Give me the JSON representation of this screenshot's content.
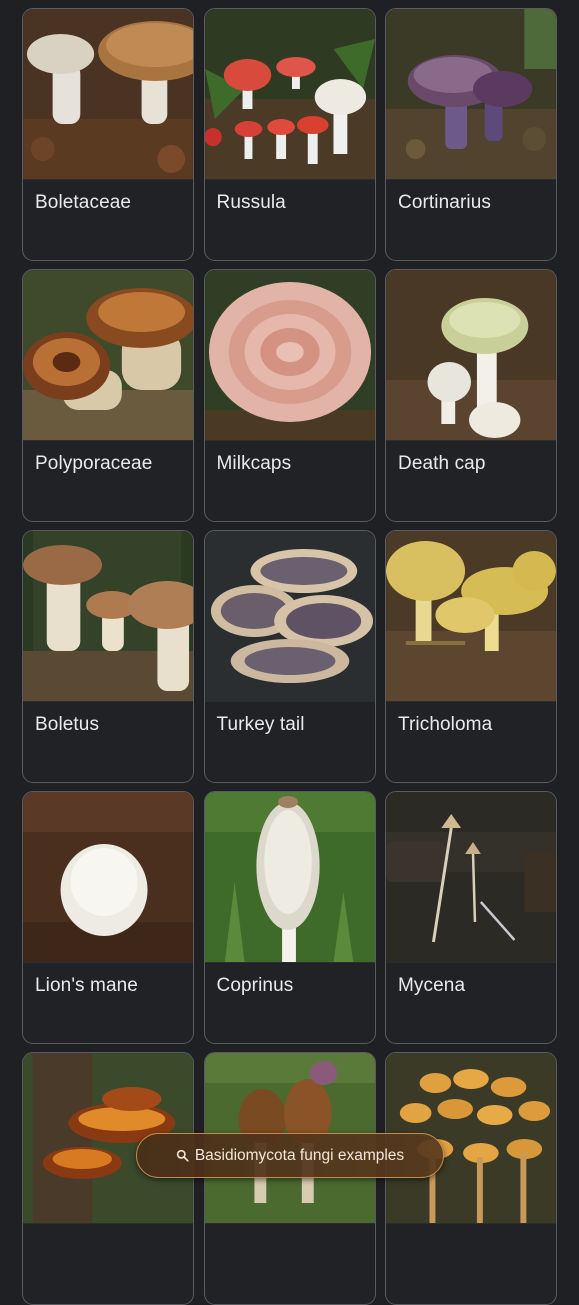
{
  "cards": [
    {
      "label": "Boletaceae"
    },
    {
      "label": "Russula"
    },
    {
      "label": "Cortinarius"
    },
    {
      "label": "Polyporaceae"
    },
    {
      "label": "Milkcaps"
    },
    {
      "label": "Death cap"
    },
    {
      "label": "Boletus"
    },
    {
      "label": "Turkey tail"
    },
    {
      "label": "Tricholoma"
    },
    {
      "label": "Lion's mane"
    },
    {
      "label": "Coprinus"
    },
    {
      "label": "Mycena"
    }
  ],
  "search_chip": {
    "label": "Basidiomycota fungi examples",
    "icon": "search-icon"
  }
}
